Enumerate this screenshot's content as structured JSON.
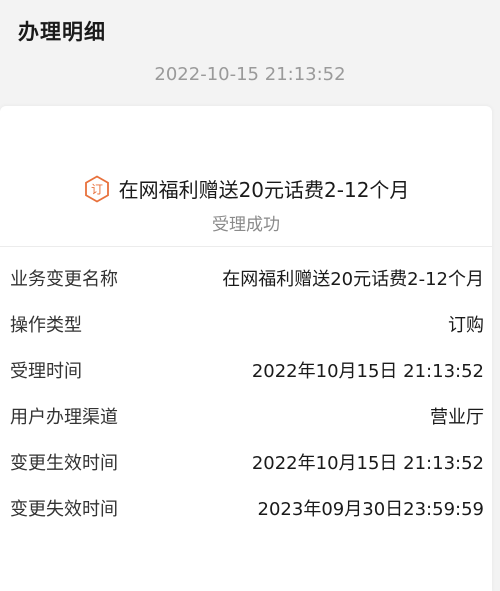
{
  "header": {
    "title": "办理明细",
    "timestamp": "2022-10-15 21:13:52"
  },
  "summary": {
    "icon": "order-icon",
    "icon_color": "#e8713c",
    "service_name": "在网福利赠送20元话费2-12个月",
    "status": "受理成功"
  },
  "details": [
    {
      "label": "业务变更名称",
      "value": "在网福利赠送20元话费2-12个月"
    },
    {
      "label": "操作类型",
      "value": "订购"
    },
    {
      "label": "受理时间",
      "value": "2022年10月15日 21:13:52"
    },
    {
      "label": "用户办理渠道",
      "value": "营业厅"
    },
    {
      "label": "变更生效时间",
      "value": "2022年10月15日 21:13:52"
    },
    {
      "label": "变更失效时间",
      "value": "2023年09月30日23:59:59"
    }
  ]
}
